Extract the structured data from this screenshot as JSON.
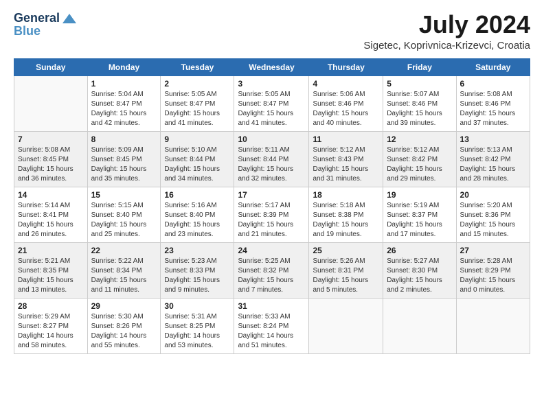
{
  "header": {
    "logo_general": "General",
    "logo_blue": "Blue",
    "title": "July 2024",
    "subtitle": "Sigetec, Koprivnica-Krizevci, Croatia"
  },
  "days_of_week": [
    "Sunday",
    "Monday",
    "Tuesday",
    "Wednesday",
    "Thursday",
    "Friday",
    "Saturday"
  ],
  "weeks": [
    [
      {
        "day": "",
        "info": ""
      },
      {
        "day": "1",
        "info": "Sunrise: 5:04 AM\nSunset: 8:47 PM\nDaylight: 15 hours\nand 42 minutes."
      },
      {
        "day": "2",
        "info": "Sunrise: 5:05 AM\nSunset: 8:47 PM\nDaylight: 15 hours\nand 41 minutes."
      },
      {
        "day": "3",
        "info": "Sunrise: 5:05 AM\nSunset: 8:47 PM\nDaylight: 15 hours\nand 41 minutes."
      },
      {
        "day": "4",
        "info": "Sunrise: 5:06 AM\nSunset: 8:46 PM\nDaylight: 15 hours\nand 40 minutes."
      },
      {
        "day": "5",
        "info": "Sunrise: 5:07 AM\nSunset: 8:46 PM\nDaylight: 15 hours\nand 39 minutes."
      },
      {
        "day": "6",
        "info": "Sunrise: 5:08 AM\nSunset: 8:46 PM\nDaylight: 15 hours\nand 37 minutes."
      }
    ],
    [
      {
        "day": "7",
        "info": "Sunrise: 5:08 AM\nSunset: 8:45 PM\nDaylight: 15 hours\nand 36 minutes."
      },
      {
        "day": "8",
        "info": "Sunrise: 5:09 AM\nSunset: 8:45 PM\nDaylight: 15 hours\nand 35 minutes."
      },
      {
        "day": "9",
        "info": "Sunrise: 5:10 AM\nSunset: 8:44 PM\nDaylight: 15 hours\nand 34 minutes."
      },
      {
        "day": "10",
        "info": "Sunrise: 5:11 AM\nSunset: 8:44 PM\nDaylight: 15 hours\nand 32 minutes."
      },
      {
        "day": "11",
        "info": "Sunrise: 5:12 AM\nSunset: 8:43 PM\nDaylight: 15 hours\nand 31 minutes."
      },
      {
        "day": "12",
        "info": "Sunrise: 5:12 AM\nSunset: 8:42 PM\nDaylight: 15 hours\nand 29 minutes."
      },
      {
        "day": "13",
        "info": "Sunrise: 5:13 AM\nSunset: 8:42 PM\nDaylight: 15 hours\nand 28 minutes."
      }
    ],
    [
      {
        "day": "14",
        "info": "Sunrise: 5:14 AM\nSunset: 8:41 PM\nDaylight: 15 hours\nand 26 minutes."
      },
      {
        "day": "15",
        "info": "Sunrise: 5:15 AM\nSunset: 8:40 PM\nDaylight: 15 hours\nand 25 minutes."
      },
      {
        "day": "16",
        "info": "Sunrise: 5:16 AM\nSunset: 8:40 PM\nDaylight: 15 hours\nand 23 minutes."
      },
      {
        "day": "17",
        "info": "Sunrise: 5:17 AM\nSunset: 8:39 PM\nDaylight: 15 hours\nand 21 minutes."
      },
      {
        "day": "18",
        "info": "Sunrise: 5:18 AM\nSunset: 8:38 PM\nDaylight: 15 hours\nand 19 minutes."
      },
      {
        "day": "19",
        "info": "Sunrise: 5:19 AM\nSunset: 8:37 PM\nDaylight: 15 hours\nand 17 minutes."
      },
      {
        "day": "20",
        "info": "Sunrise: 5:20 AM\nSunset: 8:36 PM\nDaylight: 15 hours\nand 15 minutes."
      }
    ],
    [
      {
        "day": "21",
        "info": "Sunrise: 5:21 AM\nSunset: 8:35 PM\nDaylight: 15 hours\nand 13 minutes."
      },
      {
        "day": "22",
        "info": "Sunrise: 5:22 AM\nSunset: 8:34 PM\nDaylight: 15 hours\nand 11 minutes."
      },
      {
        "day": "23",
        "info": "Sunrise: 5:23 AM\nSunset: 8:33 PM\nDaylight: 15 hours\nand 9 minutes."
      },
      {
        "day": "24",
        "info": "Sunrise: 5:25 AM\nSunset: 8:32 PM\nDaylight: 15 hours\nand 7 minutes."
      },
      {
        "day": "25",
        "info": "Sunrise: 5:26 AM\nSunset: 8:31 PM\nDaylight: 15 hours\nand 5 minutes."
      },
      {
        "day": "26",
        "info": "Sunrise: 5:27 AM\nSunset: 8:30 PM\nDaylight: 15 hours\nand 2 minutes."
      },
      {
        "day": "27",
        "info": "Sunrise: 5:28 AM\nSunset: 8:29 PM\nDaylight: 15 hours\nand 0 minutes."
      }
    ],
    [
      {
        "day": "28",
        "info": "Sunrise: 5:29 AM\nSunset: 8:27 PM\nDaylight: 14 hours\nand 58 minutes."
      },
      {
        "day": "29",
        "info": "Sunrise: 5:30 AM\nSunset: 8:26 PM\nDaylight: 14 hours\nand 55 minutes."
      },
      {
        "day": "30",
        "info": "Sunrise: 5:31 AM\nSunset: 8:25 PM\nDaylight: 14 hours\nand 53 minutes."
      },
      {
        "day": "31",
        "info": "Sunrise: 5:33 AM\nSunset: 8:24 PM\nDaylight: 14 hours\nand 51 minutes."
      },
      {
        "day": "",
        "info": ""
      },
      {
        "day": "",
        "info": ""
      },
      {
        "day": "",
        "info": ""
      }
    ]
  ]
}
